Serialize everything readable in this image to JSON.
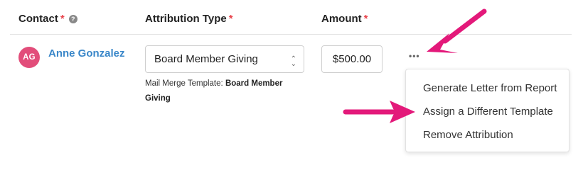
{
  "header": {
    "contact_label": "Contact",
    "attribution_label": "Attribution Type",
    "amount_label": "Amount",
    "required_mark": "*",
    "help_icon": "?"
  },
  "row": {
    "avatar_initials": "AG",
    "contact_name": "Anne Gonzalez",
    "attribution_type": "Board Member Giving",
    "template_prefix": "Mail Merge Template:",
    "template_name": "Board Member Giving",
    "amount": "$500.00",
    "more_icon": "•••"
  },
  "menu": {
    "items": [
      "Generate Letter from Report",
      "Assign a Different Template",
      "Remove Attribution"
    ]
  },
  "colors": {
    "accent_link": "#3a87c9",
    "avatar": "#e24d7a",
    "required": "#e8434b",
    "annotation_arrow": "#e3197a"
  }
}
